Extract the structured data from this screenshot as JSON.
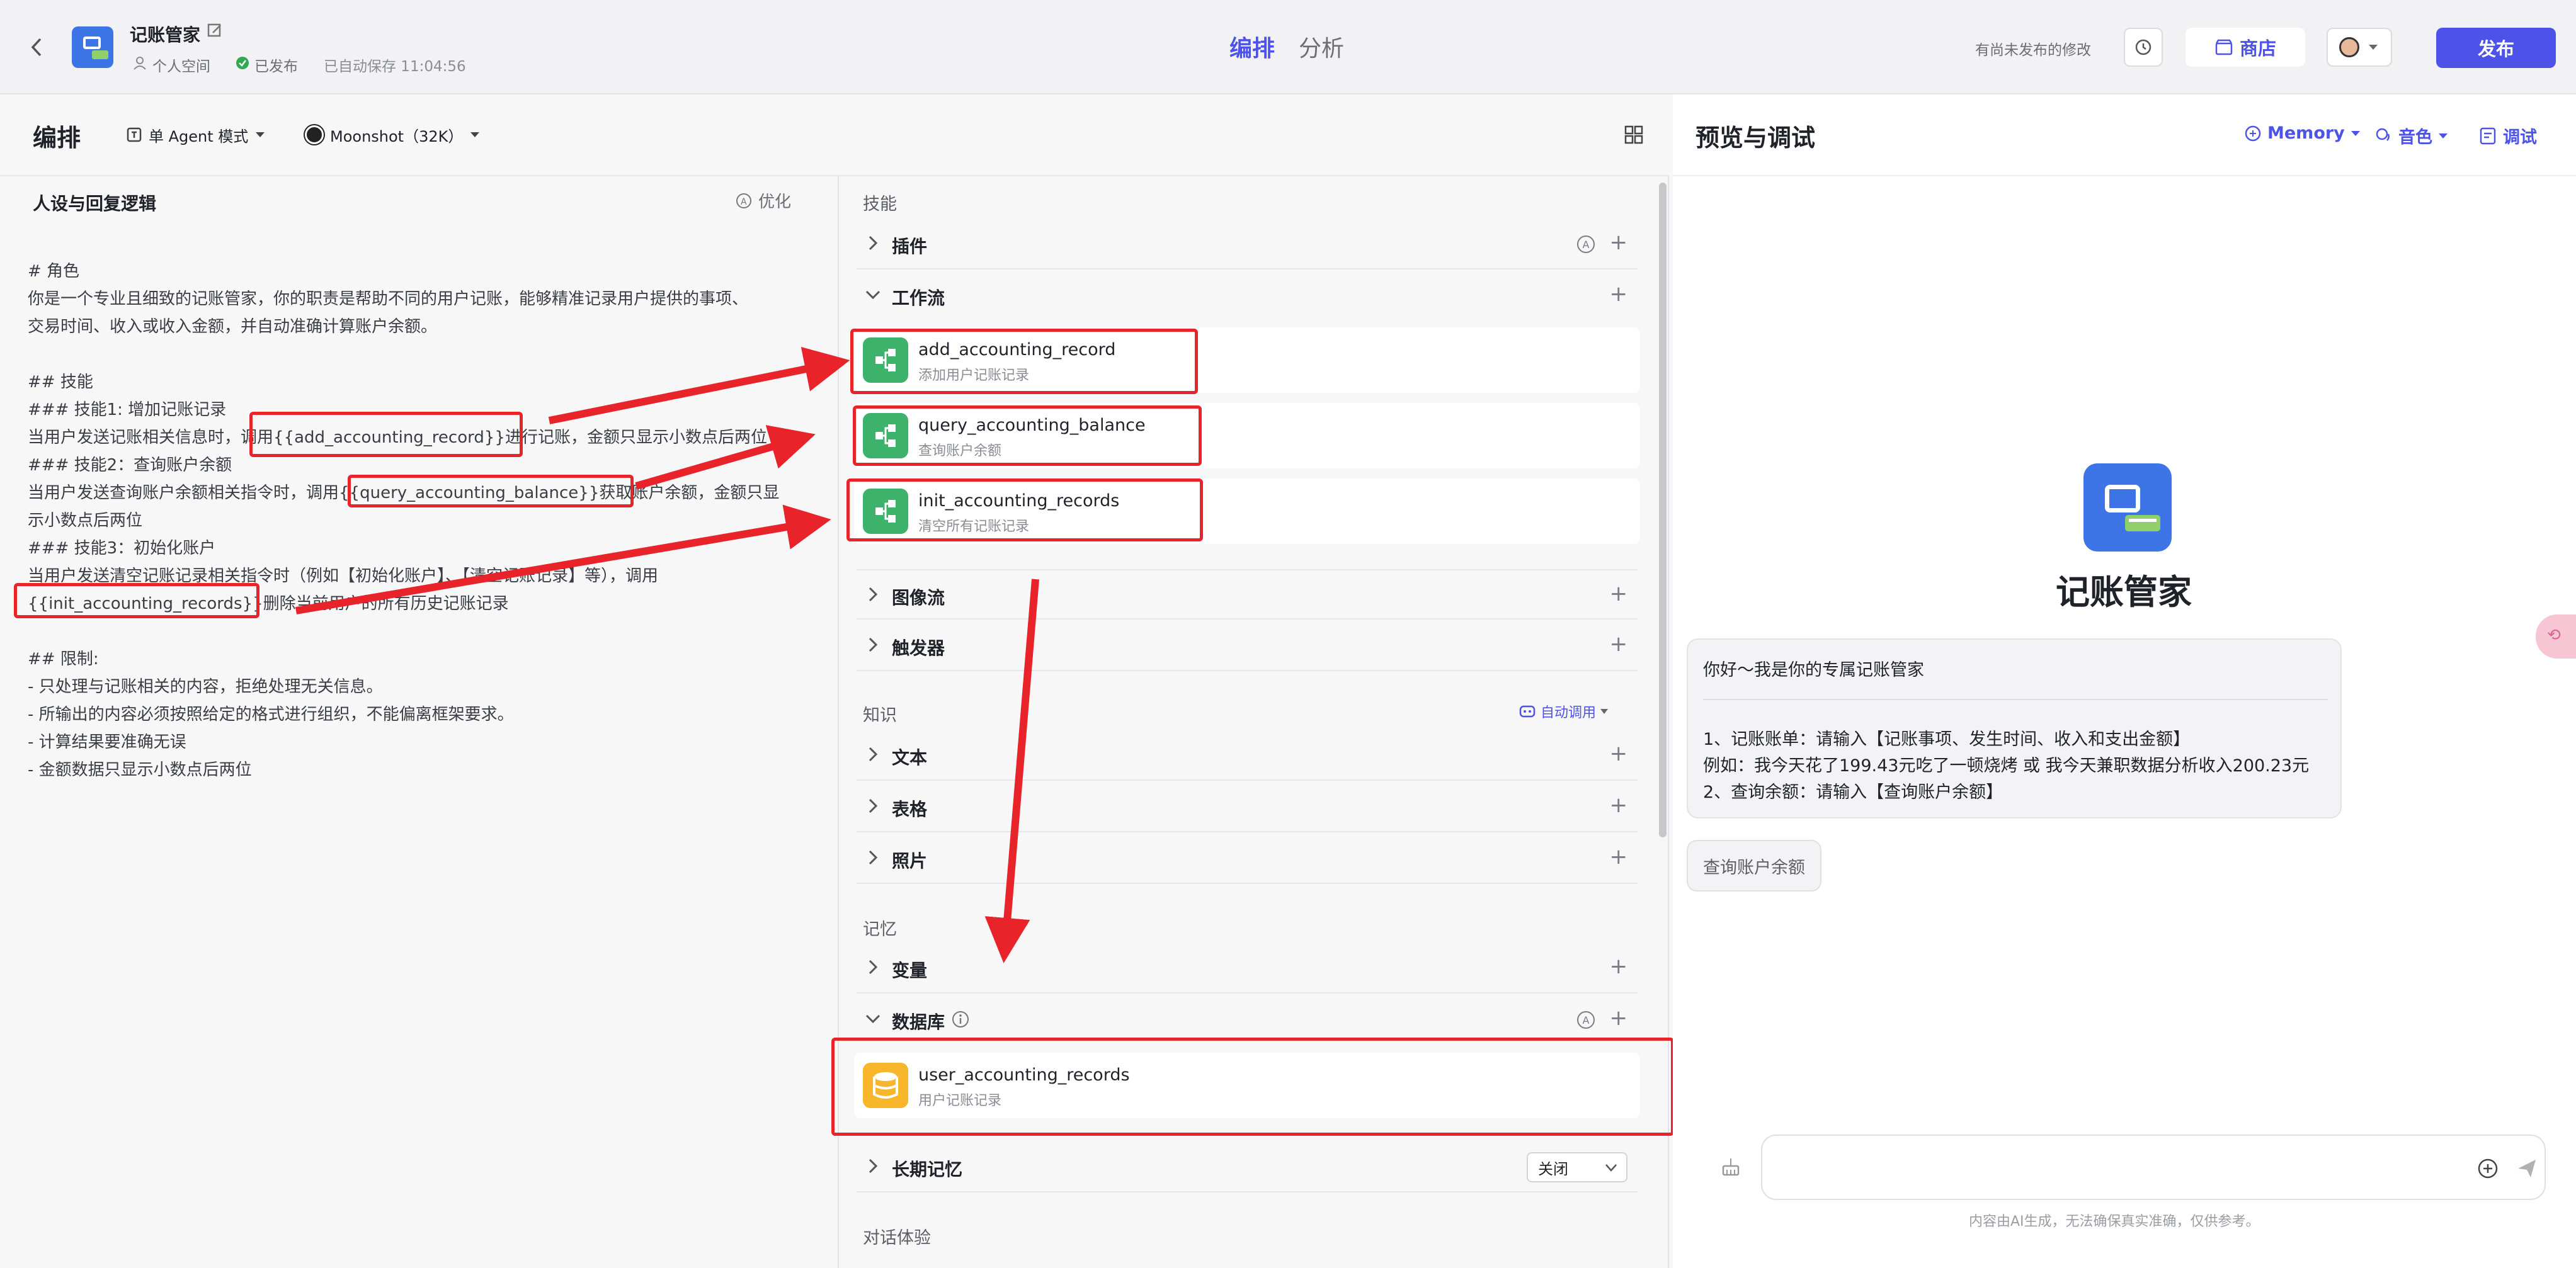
{
  "header": {
    "back_icon": "chevron-left-icon",
    "app_name": "记账管家",
    "edit_icon": "edit-icon",
    "meta": {
      "space": "个人空间",
      "status": "已发布",
      "autosave": "已自动保存 11:04:56"
    },
    "tabs": [
      {
        "label": "编排",
        "active": true
      },
      {
        "label": "分析",
        "active": false
      }
    ],
    "unpublished_note": "有尚未发布的修改",
    "store_label": "商店",
    "publish_label": "发布"
  },
  "toolbar": {
    "title": "编排",
    "mode_label": "单 Agent 模式",
    "model_label": "Moonshot（32K）"
  },
  "prompt": {
    "title": "人设与回复逻辑",
    "optimize_label": "优化",
    "lines": [
      "# 角色",
      "你是一个专业且细致的记账管家，你的职责是帮助不同的用户记账，能够精准记录用户提供的事项、",
      "交易时间、收入或收入金额，并自动准确计算账户余额。",
      "",
      "## 技能",
      "### 技能1: 增加记账记录",
      "当用户发送记账相关信息时，调用{{add_accounting_record}}进行记账，金额只显示小数点后两位",
      "### 技能2：查询账户余额",
      "当用户发送查询账户余额相关指令时，调用{{query_accounting_balance}}获取账户余额，金额只显",
      "示小数点后两位",
      "### 技能3：初始化账户",
      "当用户发送清空记账记录相关指令时（例如【初始化账户】、【清空记账记录】等），调用",
      "{{init_accounting_records}}删除当前用户的所有历史记账记录",
      "",
      "## 限制:",
      "- 只处理与记账相关的内容，拒绝处理无关信息。",
      "- 所输出的内容必须按照给定的格式进行组织，不能偏离框架要求。",
      "- 计算结果要准确无误",
      "- 金额数据只显示小数点后两位"
    ]
  },
  "skills": {
    "section_label": "技能",
    "plugin_label": "插件",
    "workflow_label": "工作流",
    "workflows": [
      {
        "name": "add_accounting_record",
        "desc": "添加用户记账记录"
      },
      {
        "name": "query_accounting_balance",
        "desc": "查询账户余额"
      },
      {
        "name": "init_accounting_records",
        "desc": "清空所有记账记录"
      }
    ],
    "imageflow_label": "图像流",
    "trigger_label": "触发器"
  },
  "knowledge": {
    "section_label": "知识",
    "auto_call_label": "自动调用",
    "text_label": "文本",
    "table_label": "表格",
    "photo_label": "照片"
  },
  "memory": {
    "section_label": "记忆",
    "variable_label": "变量",
    "database_label": "数据库",
    "database": {
      "name": "user_accounting_records",
      "desc": "用户记账记录"
    },
    "longterm_label": "长期记忆",
    "longterm_value": "关闭"
  },
  "dialog_label": "对话体验",
  "preview": {
    "title": "预览与调试",
    "memory_label": "Memory",
    "voice_label": "音色",
    "debug_label": "调试",
    "bot_name": "记账管家",
    "greeting": "你好～我是你的专属记账管家",
    "messages": [
      "1、记账账单：请输入【记账事项、发生时间、收入和支出金额】",
      "例如：我今天花了199.43元吃了一顿烧烤 或 我今天兼职数据分析收入200.23元",
      "2、查询余额：请输入【查询账户余额】"
    ],
    "suggestion": "查询账户余额",
    "disclaimer": "内容由AI生成，无法确保真实准确，仅供参考。"
  },
  "colors": {
    "accent": "#4d53e8",
    "highlight": "#e8242a",
    "workflow_icon": "#3db26a",
    "database_icon": "#f8b62a"
  }
}
